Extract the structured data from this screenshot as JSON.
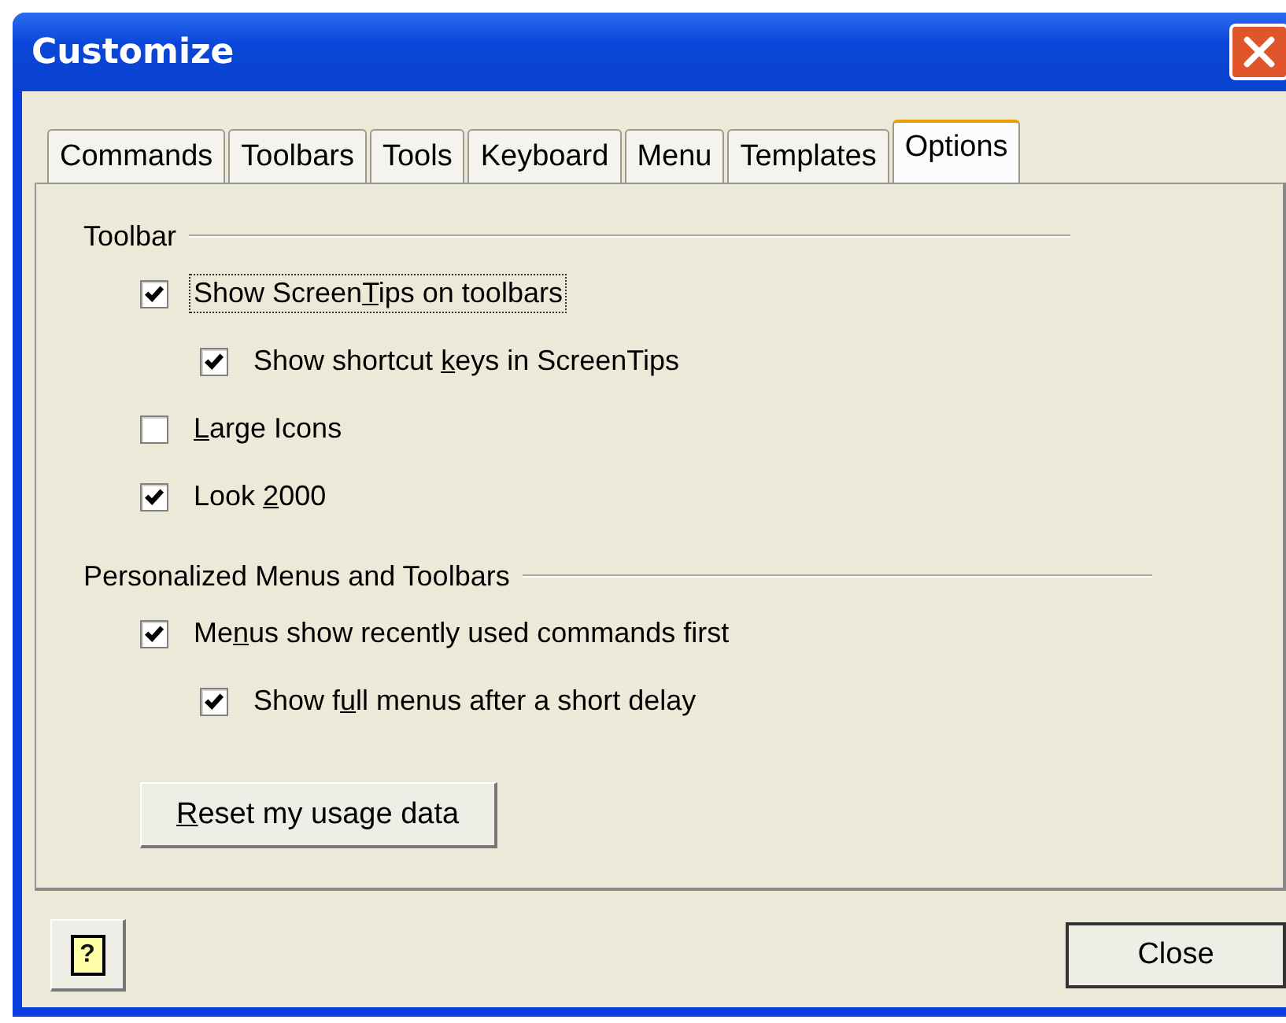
{
  "window": {
    "title": "Customize"
  },
  "tabs": [
    {
      "label": "Commands",
      "selected": false
    },
    {
      "label": "Toolbars",
      "selected": false
    },
    {
      "label": "Tools",
      "selected": false
    },
    {
      "label": "Keyboard",
      "selected": false
    },
    {
      "label": "Menu",
      "selected": false
    },
    {
      "label": "Templates",
      "selected": false
    },
    {
      "label": "Options",
      "selected": true
    }
  ],
  "sections": [
    {
      "title": "Toolbar",
      "items": [
        {
          "kind": "checkbox",
          "label_parts": [
            "Show Screen",
            "T",
            "ips on toolbars"
          ],
          "checked": true,
          "focused": true,
          "children": [
            {
              "kind": "checkbox",
              "label_parts": [
                "Show shortcut ",
                "k",
                "eys in ScreenTips"
              ],
              "checked": true,
              "focused": false
            }
          ]
        },
        {
          "kind": "checkbox",
          "label_parts": [
            "L",
            "arge Icons"
          ],
          "starts_with_key": true,
          "checked": false,
          "focused": false
        },
        {
          "kind": "checkbox",
          "label_parts": [
            "Look ",
            "2",
            "000"
          ],
          "checked": true,
          "focused": false
        }
      ]
    },
    {
      "title": "Personalized Menus and Toolbars",
      "items": [
        {
          "kind": "checkbox",
          "label_parts": [
            "Me",
            "n",
            "us show recently used commands first"
          ],
          "checked": true,
          "focused": false,
          "children": [
            {
              "kind": "checkbox",
              "label_parts": [
                "Show f",
                "u",
                "ll menus after a short delay"
              ],
              "checked": true,
              "focused": false
            }
          ]
        },
        {
          "kind": "button",
          "label_parts": [
            "R",
            "eset my usage data"
          ],
          "starts_with_key": true
        }
      ]
    }
  ],
  "help_button": {
    "label": "?"
  },
  "close_button": {
    "label": "Close"
  }
}
